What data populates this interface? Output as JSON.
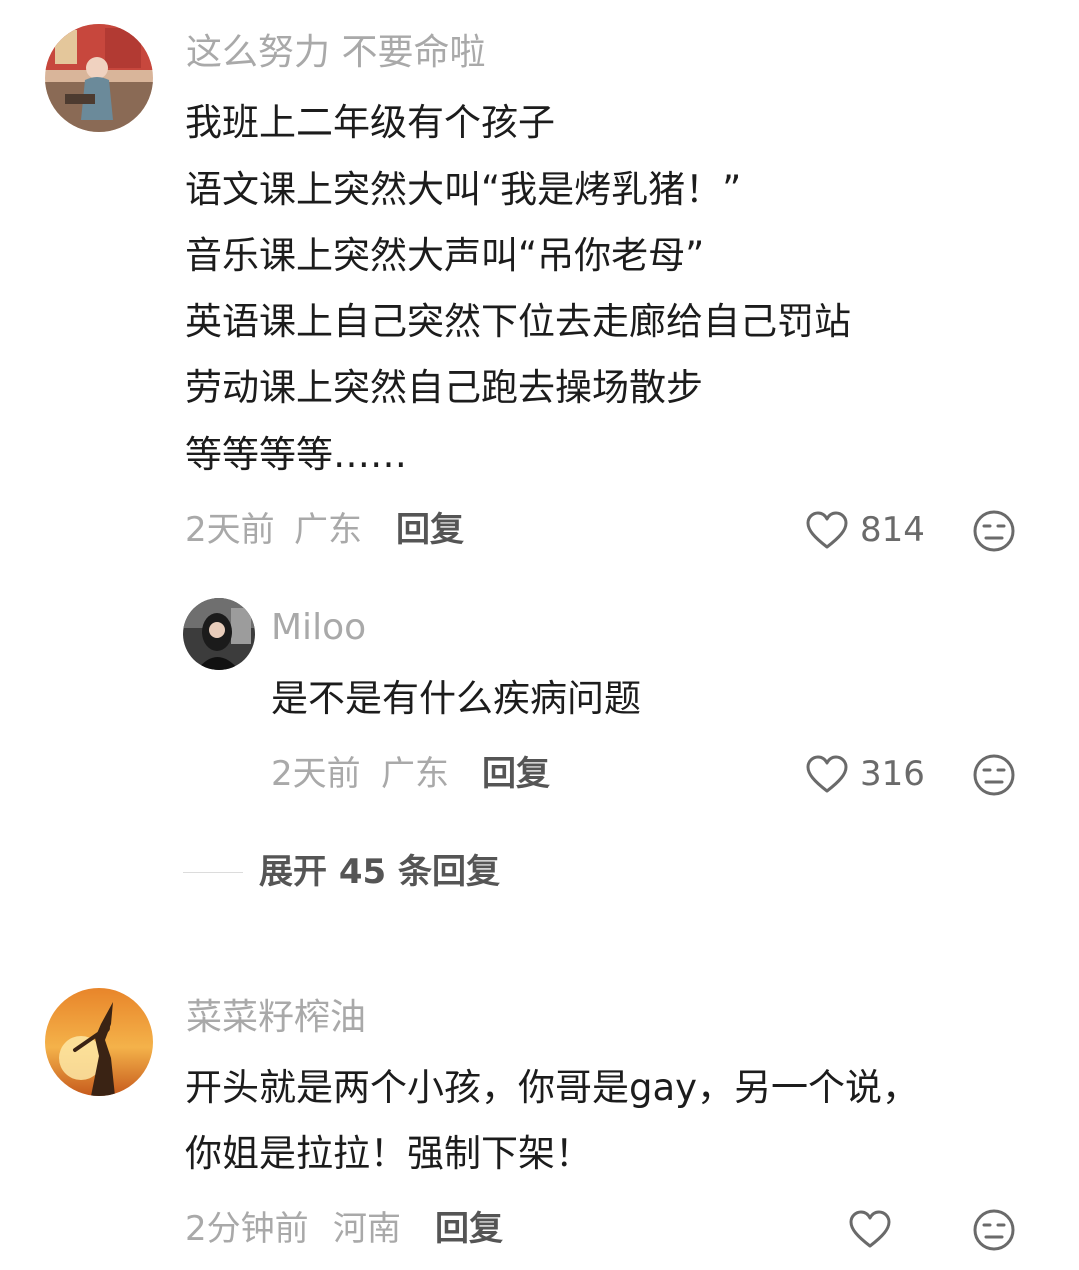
{
  "comments": [
    {
      "username": "这么努力 不要命啦",
      "lines": [
        "我班上二年级有个孩子",
        "语文课上突然大叫“我是烤乳猪！”",
        "音乐课上突然大声叫“吊你老母”",
        "英语课上自己突然下位去走廊给自己罚站",
        "劳动课上突然自己跑去操场散步",
        "等等等等……"
      ],
      "time": "2天前",
      "location": "广东",
      "reply_label": "回复",
      "likes": "814",
      "reply": {
        "username": "Miloo",
        "lines": [
          "是不是有什么疾病问题"
        ],
        "time": "2天前",
        "location": "广东",
        "reply_label": "回复",
        "likes": "316"
      },
      "expand_label": "展开 45 条回复"
    },
    {
      "username": "菜菜籽榨油",
      "lines": [
        "开头就是两个小孩，你哥是gay，另一个说，",
        "你姐是拉拉！强制下架！"
      ],
      "time": "2分钟前",
      "location": "河南",
      "reply_label": "回复",
      "likes": ""
    }
  ],
  "icons": {
    "like": "heart-outline-icon",
    "dislike": "meh-face-icon"
  },
  "colors": {
    "username": "#a9a9a9",
    "text": "#1c1c1c",
    "meta": "#a9a9a9",
    "action": "#555555"
  }
}
